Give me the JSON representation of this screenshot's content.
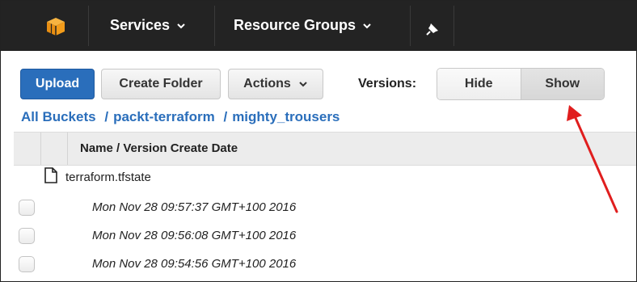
{
  "nav": {
    "services_label": "Services",
    "resource_groups_label": "Resource Groups",
    "logo_icon": "aws-cube-icon",
    "pin_icon": "pushpin-icon"
  },
  "toolbar": {
    "upload_label": "Upload",
    "create_folder_label": "Create Folder",
    "actions_label": "Actions",
    "versions_label": "Versions:",
    "hide_label": "Hide",
    "show_label": "Show",
    "selected_version_option": "Show"
  },
  "breadcrumb": {
    "items": [
      "All Buckets",
      "packt-terraform",
      "mighty_trousers"
    ],
    "separator": "/"
  },
  "table": {
    "column_header": "Name / Version Create Date",
    "file": {
      "name": "terraform.tfstate",
      "icon": "file-icon"
    },
    "versions": [
      "Mon Nov 28 09:57:37 GMT+100 2016",
      "Mon Nov 28 09:56:08 GMT+100 2016",
      "Mon Nov 28 09:54:56 GMT+100 2016"
    ]
  },
  "colors": {
    "topbar": "#232323",
    "primary": "#2a6ebb",
    "link": "#2a6ebb",
    "annotation_arrow": "#e01e1e",
    "logo": "#f19e1b"
  }
}
